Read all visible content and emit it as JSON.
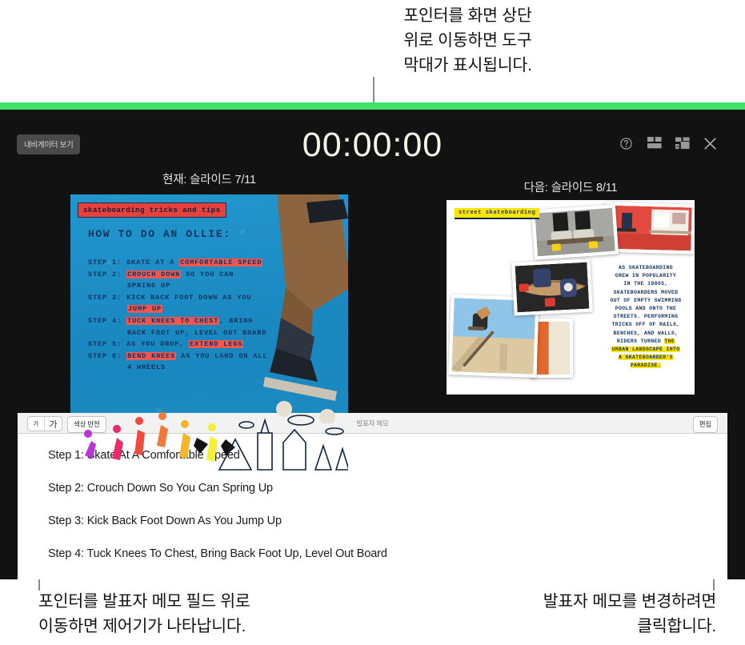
{
  "callouts": {
    "top": "포인터를 화면 상단\n위로 이동하면 도구\n막대가 표시됩니다.",
    "bottom_left": "포인터를 발표자 메모 필드 위로\n이동하면 제어기가 나타납니다.",
    "bottom_right": "발표자 메모를 변경하려면\n클릭합니다."
  },
  "toolbar": {
    "navigator_button": "내비게이터 보기",
    "timer": "00:00:00",
    "icons": [
      {
        "name": "help-icon",
        "title": "도움말"
      },
      {
        "name": "layout-icon",
        "title": "레이아웃"
      },
      {
        "name": "swap-displays-icon",
        "title": "디스플레이 전환"
      },
      {
        "name": "close-icon",
        "title": "닫기"
      }
    ]
  },
  "slides": {
    "current_label": "현재: 슬라이드 7/11",
    "next_label": "다음: 슬라이드 8/11",
    "current": {
      "tag": "skateboarding tricks and tips",
      "heading": "HOW TO DO AN OLLIE:",
      "steps": [
        {
          "label": "STEP 1:",
          "parts": [
            {
              "t": " SKATE AT A ",
              "hl": false
            },
            {
              "t": "COMFORTABLE SPEED",
              "hl": true
            }
          ]
        },
        {
          "label": "STEP 2:",
          "parts": [
            {
              "t": " ",
              "hl": false
            },
            {
              "t": "CROUCH DOWN",
              "hl": true
            },
            {
              "t": " SO YOU CAN",
              "hl": false
            }
          ]
        },
        {
          "label": "",
          "parts": [
            {
              "t": "SPRING UP",
              "hl": false
            }
          ],
          "indent": true
        },
        {
          "label": "STEP 3:",
          "parts": [
            {
              "t": " KICK BACK FOOT DOWN AS YOU",
              "hl": false
            }
          ]
        },
        {
          "label": "",
          "parts": [
            {
              "t": "JUMP UP",
              "hl": true
            }
          ],
          "indent": true
        },
        {
          "label": "STEP 4:",
          "parts": [
            {
              "t": " ",
              "hl": false
            },
            {
              "t": "TUCK KNEES TO CHEST",
              "hl": true
            },
            {
              "t": ", BRING",
              "hl": false
            }
          ]
        },
        {
          "label": "",
          "parts": [
            {
              "t": "BACK FOOT UP, LEVEL OUT BOARD",
              "hl": false
            }
          ],
          "indent": true
        },
        {
          "label": "STEP 5:",
          "parts": [
            {
              "t": " AS YOU DROP, ",
              "hl": false
            },
            {
              "t": "EXTEND LEGS",
              "hl": true
            }
          ]
        },
        {
          "label": "STEP 6:",
          "parts": [
            {
              "t": " ",
              "hl": false
            },
            {
              "t": "BEND KNEES",
              "hl": true
            },
            {
              "t": " AS YOU LAND ON ALL",
              "hl": false
            }
          ]
        },
        {
          "label": "",
          "parts": [
            {
              "t": "4 WHEELS",
              "hl": false
            }
          ],
          "indent": true
        }
      ]
    },
    "next": {
      "tag": "street skateboarding",
      "body_lines": [
        {
          "t": "AS SKATEBOARDING",
          "hl": false
        },
        {
          "t": "GREW IN POPULARITY",
          "hl": false
        },
        {
          "t": "IN THE 1980S,",
          "hl": false
        },
        {
          "t": "SKATEBOARDERS MOVED",
          "hl": false
        },
        {
          "t": "OUT OF EMPTY SWIMMING",
          "hl": false
        },
        {
          "t": "POOLS AND ONTO THE",
          "hl": false
        },
        {
          "t": "STREETS. PERFORMING",
          "hl": false
        },
        {
          "t": "TRICKS OFF OF RAILS,",
          "hl": false
        },
        {
          "t": "BENCHES, AND WALLS,",
          "hl": false
        },
        {
          "t": "RIDERS TURNED THE",
          "hl": "partial"
        },
        {
          "t": "URBAN LANDSCAPE INTO",
          "hl": true
        },
        {
          "t": "A SKATEBOARDER'S",
          "hl": true
        },
        {
          "t": "PARADISE.",
          "hl": true
        }
      ]
    }
  },
  "notes": {
    "toolbar": {
      "font_small": "가",
      "font_large": "가",
      "invert_colors": "색상 반전",
      "title": "발표자 메모",
      "edit": "편집"
    },
    "lines": [
      "Step 1: Skate At A Comfortable Speed",
      "Step 2: Crouch Down So You Can Spring Up",
      "Step 3: Kick Back Foot Down As You Jump Up",
      "Step 4: Tuck Knees To Chest, Bring Back Foot Up, Level Out Board"
    ]
  },
  "colors": {
    "accent_green": "#3fe167",
    "window_bg": "#121212",
    "slide_blue": "#1e8fc6",
    "highlight_red": "#f1574f",
    "highlight_yellow": "#ffe600"
  }
}
